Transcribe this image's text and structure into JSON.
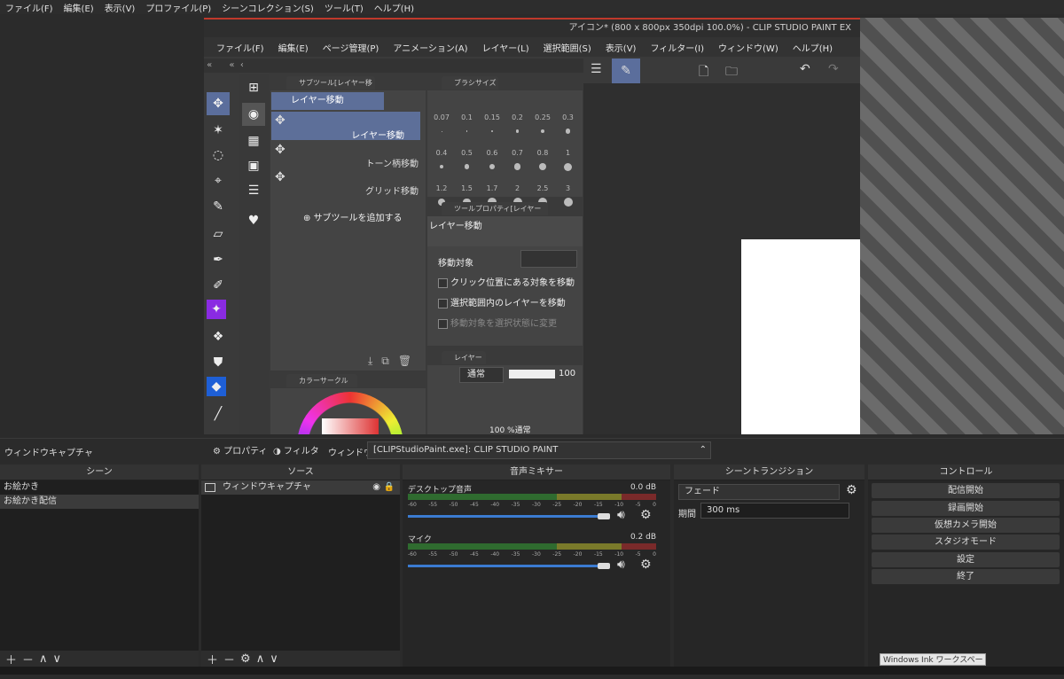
{
  "obs_menu": [
    "ファイル(F)",
    "編集(E)",
    "表示(V)",
    "プロファイル(P)",
    "シーンコレクション(S)",
    "ツール(T)",
    "ヘルプ(H)"
  ],
  "csp": {
    "title": "アイコン* (800 x 800px 350dpi 100.0%)  - CLIP STUDIO PAINT EX",
    "menu": [
      "ファイル(F)",
      "編集(E)",
      "ページ管理(P)",
      "アニメーション(A)",
      "レイヤー(L)",
      "選択範囲(S)",
      "表示(V)",
      "フィルター(I)",
      "ウィンドウ(W)",
      "ヘルプ(H)"
    ],
    "subtool_tab": "サブツール[レイヤー移動]",
    "subtool_header": "レイヤー移動",
    "subtools": [
      "レイヤー移動",
      "トーン柄移動",
      "グリッド移動"
    ],
    "add_subtool": "サブツールを追加する",
    "brush_tab": "ブラシサイズ",
    "brush_sizes": [
      "0.07",
      "0.1",
      "0.15",
      "0.2",
      "0.25",
      "0.3",
      "0.4",
      "0.5",
      "0.6",
      "0.7",
      "0.8",
      "1",
      "1.2",
      "1.5",
      "1.7",
      "2",
      "2.5",
      "3"
    ],
    "toolprop_tab": "ツールプロパティ[レイヤー移動]",
    "toolprop_title": "レイヤー移動",
    "move_target_label": "移動対象",
    "options": [
      "クリック位置にある対象を移動",
      "選択範囲内のレイヤーを移動",
      "移動対象を選択状態に変更"
    ],
    "layer_tab": "レイヤー",
    "blend_mode": "通常",
    "opacity": "100",
    "layer_row": "100 %通常",
    "colorcircle_tab": "カラーサークル"
  },
  "obs": {
    "source_label": "ウィンドウキャプチャ",
    "properties_btn": "プロパティ",
    "filters_btn": "フィルタ",
    "window_label": "ウィンドウ",
    "window_value": "[CLIPStudioPaint.exe]: CLIP STUDIO PAINT",
    "scenes_title": "シーン",
    "scenes": [
      "お絵かき",
      "お絵かき配信"
    ],
    "sources_title": "ソース",
    "sources": [
      "ウィンドウキャプチャ"
    ],
    "mixer_title": "音声ミキサー",
    "mixer": [
      {
        "name": "デスクトップ音声",
        "db": "0.0 dB",
        "level": 0.95
      },
      {
        "name": "マイク",
        "db": "0.2 dB",
        "level": 0.95
      }
    ],
    "scale_ticks": [
      "-60",
      "-55",
      "-50",
      "-45",
      "-40",
      "-35",
      "-30",
      "-25",
      "-20",
      "-15",
      "-10",
      "-5",
      "0"
    ],
    "transition_title": "シーントランジション",
    "transition": "フェード",
    "duration_label": "期間",
    "duration": "300 ms",
    "controls_title": "コントロール",
    "controls": [
      "配信開始",
      "録画開始",
      "仮想カメラ開始",
      "スタジオモード",
      "設定",
      "終了"
    ],
    "ink_tooltip": "Windows Ink ワークスペース"
  }
}
